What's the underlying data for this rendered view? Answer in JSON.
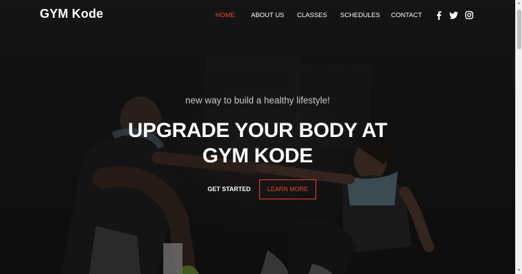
{
  "brand": {
    "name": "GYM Kode"
  },
  "nav": {
    "items": [
      {
        "label": "HOME",
        "active": true
      },
      {
        "label": "ABOUT US",
        "active": false
      },
      {
        "label": "CLASSES",
        "active": false
      },
      {
        "label": "SCHEDULES",
        "active": false
      },
      {
        "label": "CONTACT",
        "active": false
      }
    ],
    "social": [
      {
        "icon": "facebook-icon"
      },
      {
        "icon": "twitter-icon"
      },
      {
        "icon": "instagram-icon"
      }
    ]
  },
  "hero": {
    "tagline": "new way to build a healthy lifestyle!",
    "headline": "UPGRADE YOUR BODY AT GYM KODE",
    "primary_button": "GET STARTED",
    "secondary_button": "LEARN MORE"
  },
  "colors": {
    "accent": "#e8472d",
    "background": "#151515",
    "text": "#ffffff"
  }
}
